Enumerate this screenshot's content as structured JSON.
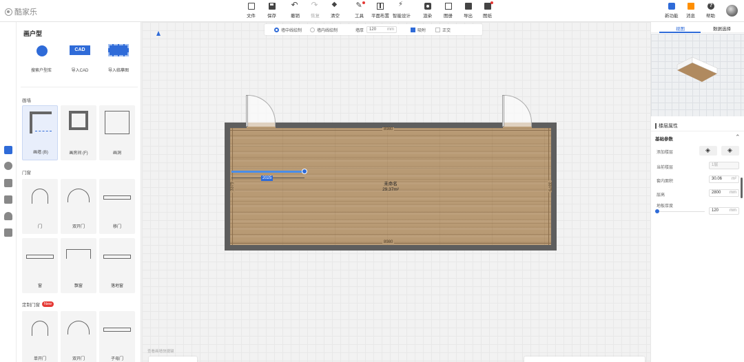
{
  "app": {
    "logo_text": "酷家乐"
  },
  "toolbar": {
    "items": [
      {
        "label": "文件",
        "icon": "file-icon"
      },
      {
        "label": "保存",
        "icon": "save-icon"
      },
      {
        "label": "撤销",
        "icon": "undo-icon"
      },
      {
        "label": "恢复",
        "icon": "redo-icon"
      },
      {
        "label": "清空",
        "icon": "clear-icon"
      },
      {
        "label": "工具",
        "icon": "wrench-icon"
      },
      {
        "label": "平面布置",
        "icon": "layout-icon"
      },
      {
        "label": "智能设计",
        "icon": "ai-design-icon"
      },
      {
        "label": "渲染",
        "icon": "camera-icon"
      },
      {
        "label": "图册",
        "icon": "album-icon"
      },
      {
        "label": "导出",
        "icon": "export-icon"
      },
      {
        "label": "图纸",
        "icon": "drawing-icon"
      }
    ],
    "right": [
      {
        "label": "新功能",
        "icon": "new-feature-icon"
      },
      {
        "label": "消息",
        "icon": "gift-icon"
      },
      {
        "label": "帮助",
        "icon": "help-icon"
      }
    ]
  },
  "left_panel": {
    "title": "画户型",
    "top_items": [
      "搜索户型库",
      "导入CAD",
      "导入临摹图"
    ],
    "cad_badge": "CAD",
    "sections": {
      "walls": "画墙",
      "doors_windows": "门窗",
      "custom_doors": "定制门窗",
      "new_badge": "New"
    },
    "wall_items": [
      "画墙 (B)",
      "画房间 (F)",
      "画洞"
    ],
    "door_items": [
      "门",
      "双开门",
      "移门"
    ],
    "window_items": [
      "窗",
      "飘窗",
      "落地窗"
    ],
    "custom_items": [
      "单开门",
      "双开门",
      "子母门"
    ]
  },
  "canvas": {
    "draw_mode_center": "墙中线绘制",
    "draw_mode_inner": "墙内线绘制",
    "wall_thickness_label": "墙厚",
    "wall_thickness_value": "120",
    "wall_thickness_unit": "mm",
    "snap_label": "吸附",
    "ortho_label": "正交",
    "dim_top": "8980",
    "dim_bottom": "8980",
    "dim_left": "3375",
    "dim_right": "3375",
    "room_name": "未命名",
    "room_area": "29.37m²",
    "drawing_length": "2025",
    "bottom_note": "查看画墙快捷键"
  },
  "right_panel": {
    "tab_view": "视图",
    "tab_data": "数据选择",
    "floor_props_title": "楼层属性",
    "basic_params": "基础参数",
    "add_floor": "添加楼层",
    "current_floor_label": "当前楼层",
    "current_floor_value": "1层",
    "inner_area_label": "套内面积",
    "inner_area_value": "30.06",
    "inner_area_unit": "m²",
    "floor_height_label": "层高",
    "floor_height_value": "2800",
    "floor_height_unit": "mm",
    "slab_thickness_label": "地板厚度",
    "slab_thickness_value": "120",
    "slab_thickness_unit": "mm"
  },
  "colors": {
    "accent": "#2f6bd8",
    "wall": "#5e5e5e",
    "floor": "#b89a74",
    "badge": "#e53935"
  }
}
